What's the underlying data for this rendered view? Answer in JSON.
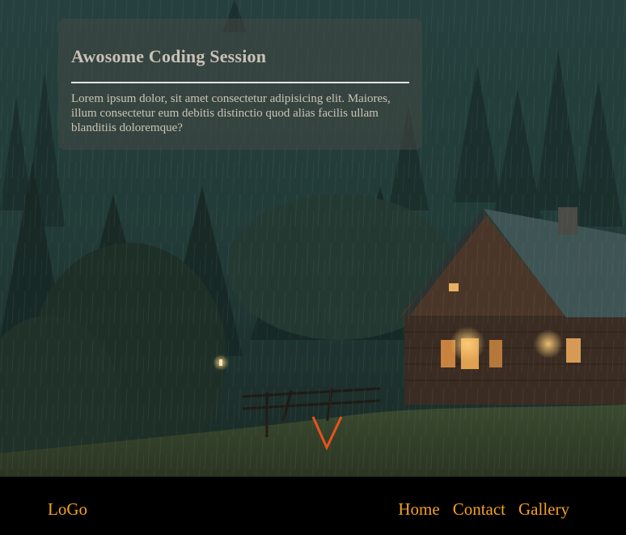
{
  "card": {
    "title": "Awosome Coding Session",
    "text": "Lorem ipsum dolor, sit amet consectetur adipisicing elit. Maiores, illum consectetur eum debitis distinctio quod alias facilis ullam blanditiis doloremque?"
  },
  "scroll": {
    "icon": "chevron-down-icon",
    "color": "#e8531c"
  },
  "nav": {
    "logo": "LoGo",
    "links": [
      "Home",
      "Contact",
      "Gallery"
    ],
    "accent": "#f5a023"
  },
  "background": {
    "description_icon": "forest-cabin-rain-image"
  }
}
